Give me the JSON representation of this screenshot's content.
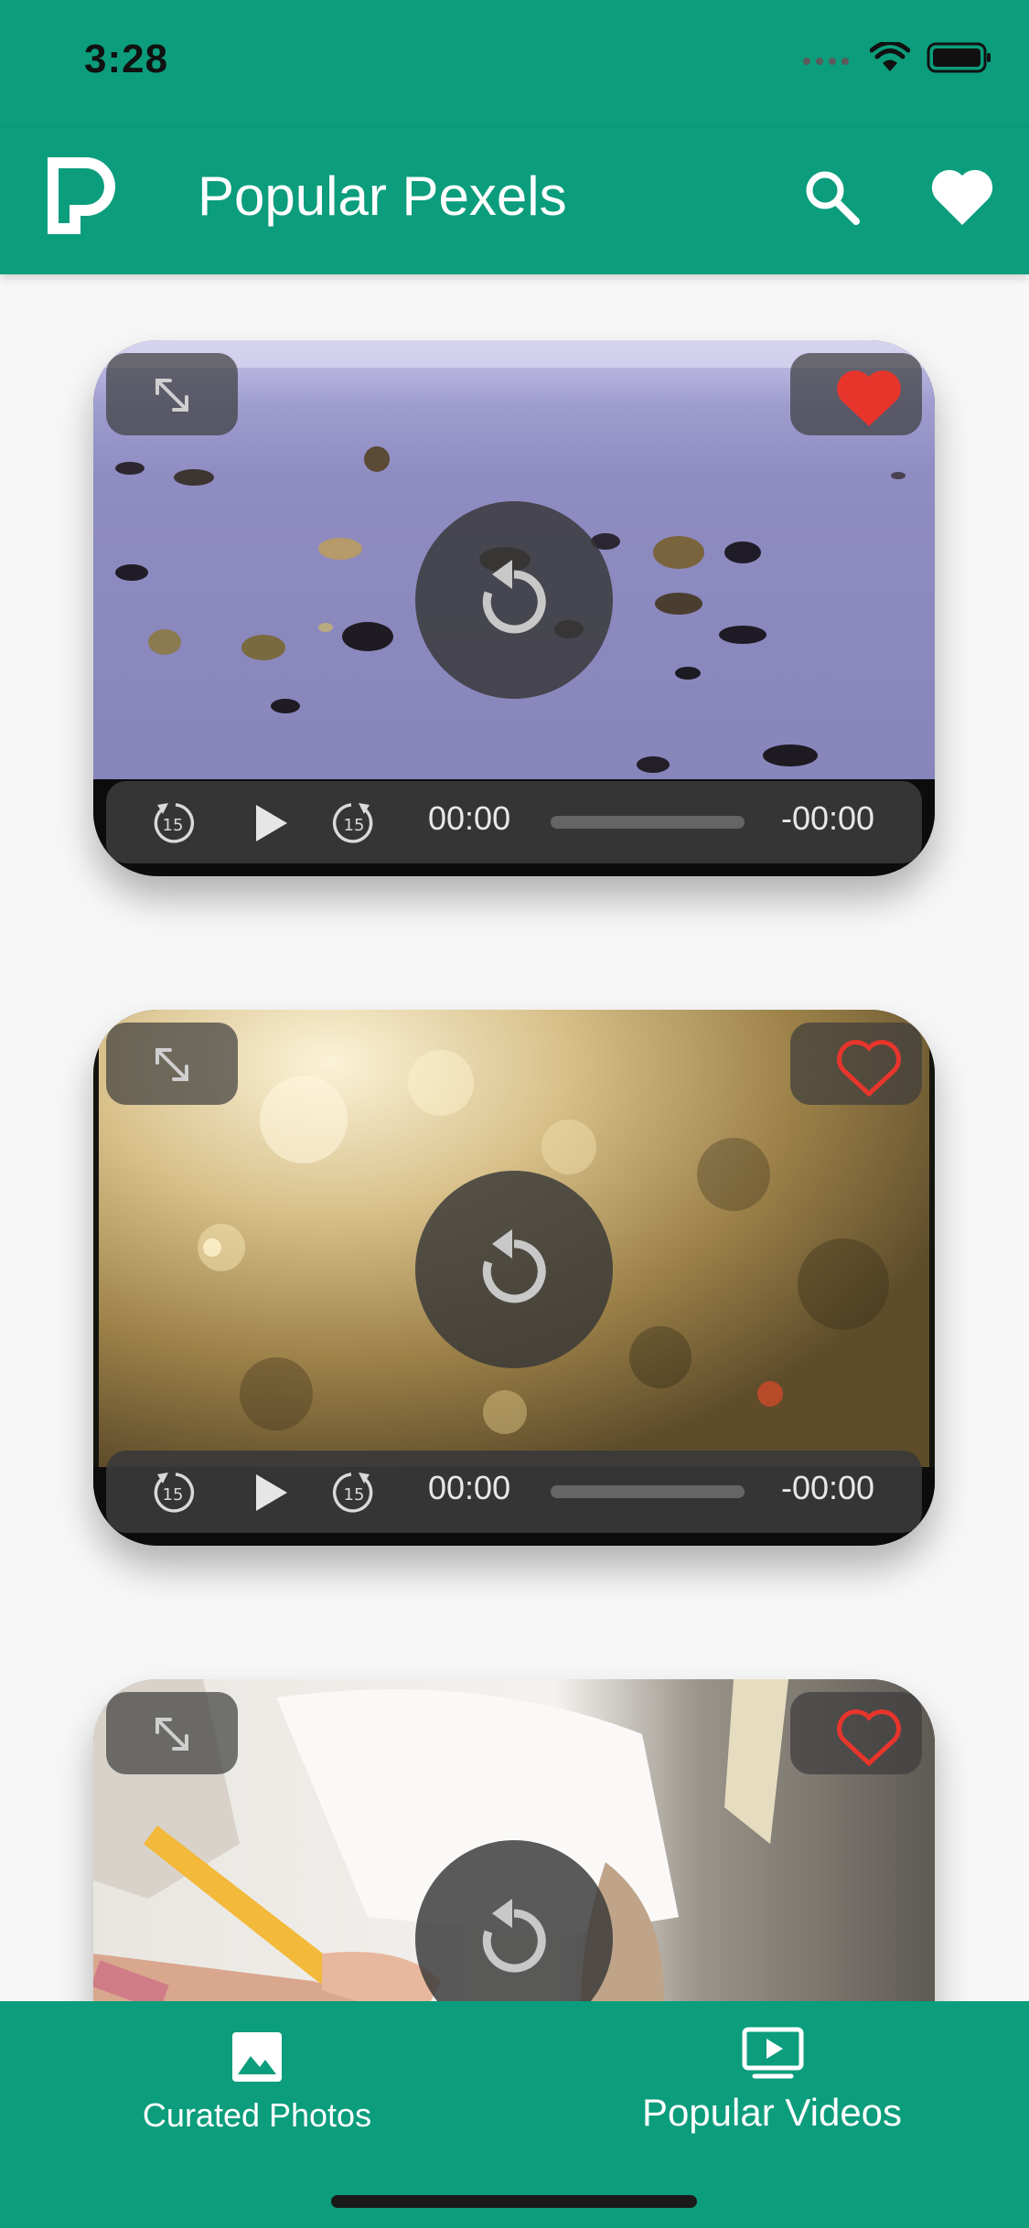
{
  "status_bar": {
    "time": "3:28"
  },
  "app_bar": {
    "title": "Popular Pexels",
    "logo_icon": "pexels-logo-icon",
    "search_icon": "search-icon",
    "favorites_icon": "heart-icon"
  },
  "videos": [
    {
      "scene": "beach-shells",
      "favorited": true,
      "elapsed": "00:00",
      "remaining": "-00:00"
    },
    {
      "scene": "sunlit-bokeh",
      "favorited": false,
      "elapsed": "00:00",
      "remaining": "-00:00"
    },
    {
      "scene": "child-drawing",
      "favorited": false
    }
  ],
  "bottom_nav": {
    "tabs": [
      {
        "label": "Curated Photos",
        "icon": "image-icon",
        "selected": false
      },
      {
        "label": "Popular Videos",
        "icon": "video-play-icon",
        "selected": true
      }
    ]
  },
  "colors": {
    "brand": "#0b9d7c",
    "favorite": "#e8352c"
  }
}
